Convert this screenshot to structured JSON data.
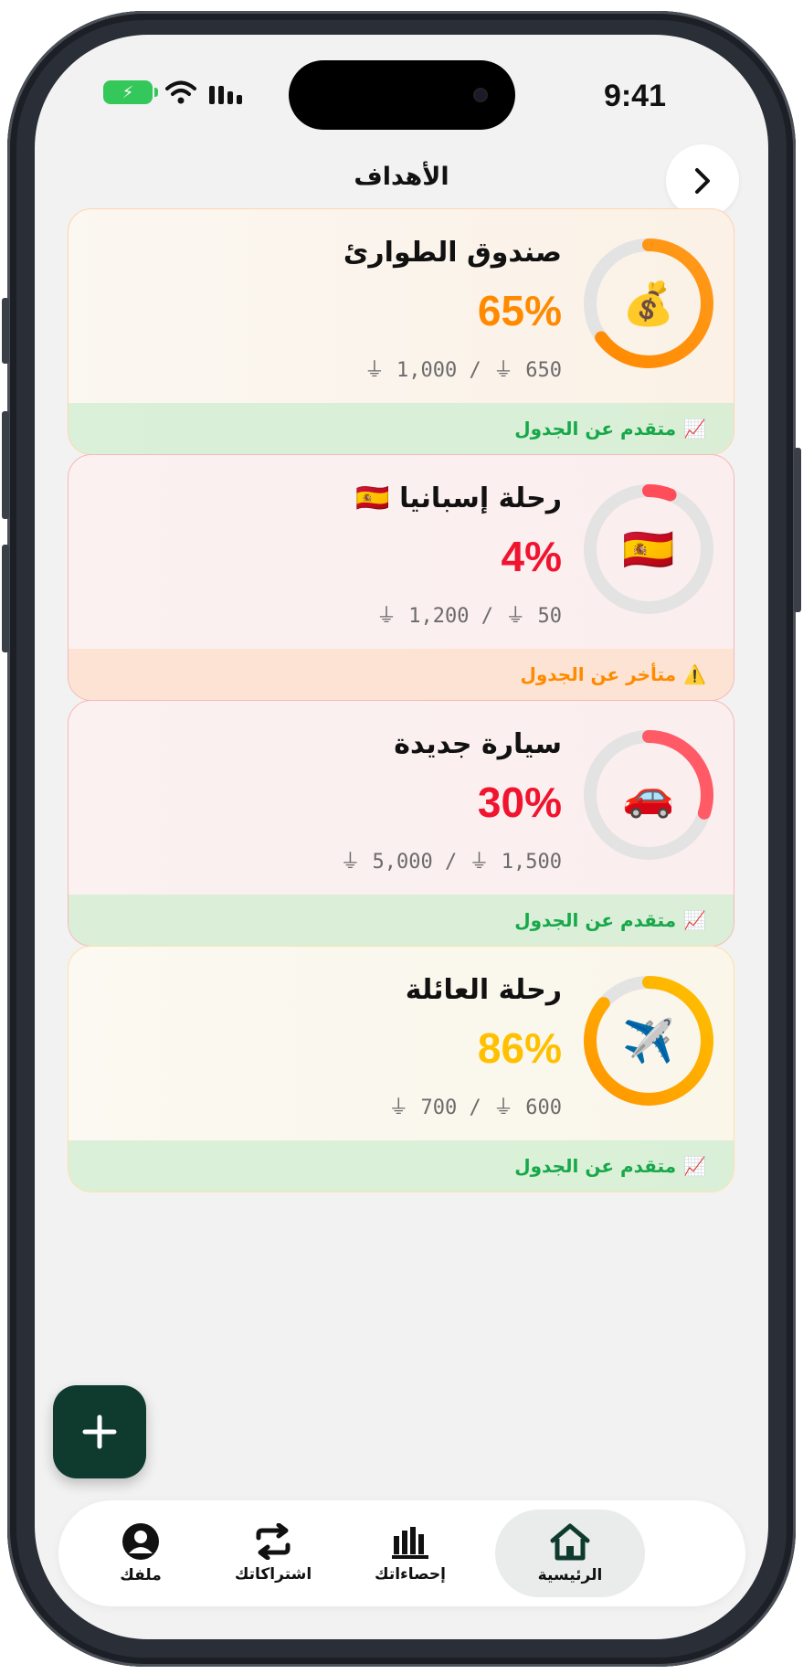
{
  "status_bar": {
    "time": "9:41"
  },
  "header": {
    "title": "الأهداف"
  },
  "colors": {
    "orange": "#ff8a00",
    "red": "#f0142f",
    "yellow": "#ffc000",
    "green_text": "#17a84a",
    "warn_text": "#ff8a00",
    "fab_bg": "#0e3b2e"
  },
  "goals": [
    {
      "title": "صندوق الطوارئ",
      "percent": "65%",
      "progress": 0.65,
      "amount": "⏚ 1,000 / ⏚ 650",
      "icon": "money-bag-icon",
      "icon_glyph": "💰",
      "status_text": "متقدم عن الجدول",
      "status_icon": "📈",
      "status_type": "ahead"
    },
    {
      "title": "رحلة إسبانيا 🇪🇸",
      "percent": "4%",
      "progress": 0.04,
      "amount": "⏚ 1,200 / ⏚ 50",
      "icon": "spain-flag-icon",
      "icon_glyph": "🇪🇸",
      "status_text": "متأخر عن الجدول",
      "status_icon": "⚠️",
      "status_type": "behind"
    },
    {
      "title": "سيارة جديدة",
      "percent": "30%",
      "progress": 0.3,
      "amount": "⏚ 5,000 / ⏚ 1,500",
      "icon": "car-icon",
      "icon_glyph": "🚗",
      "status_text": "متقدم عن الجدول",
      "status_icon": "📈",
      "status_type": "ahead"
    },
    {
      "title": "رحلة العائلة",
      "percent": "86%",
      "progress": 0.86,
      "amount": "⏚ 700 / ⏚ 600",
      "icon": "airplane-icon",
      "icon_glyph": "✈️",
      "status_text": "متقدم عن الجدول",
      "status_icon": "📈",
      "status_type": "ahead"
    }
  ],
  "fab": {
    "label": "+"
  },
  "bottom_nav": {
    "items": [
      {
        "label": "ملفك",
        "icon": "profile-icon"
      },
      {
        "label": "اشتراكاتك",
        "icon": "repeat-icon"
      },
      {
        "label": "إحصاءاتك",
        "icon": "bar-chart-icon"
      },
      {
        "label": "الرئيسية",
        "icon": "home-icon",
        "active": true
      }
    ]
  }
}
